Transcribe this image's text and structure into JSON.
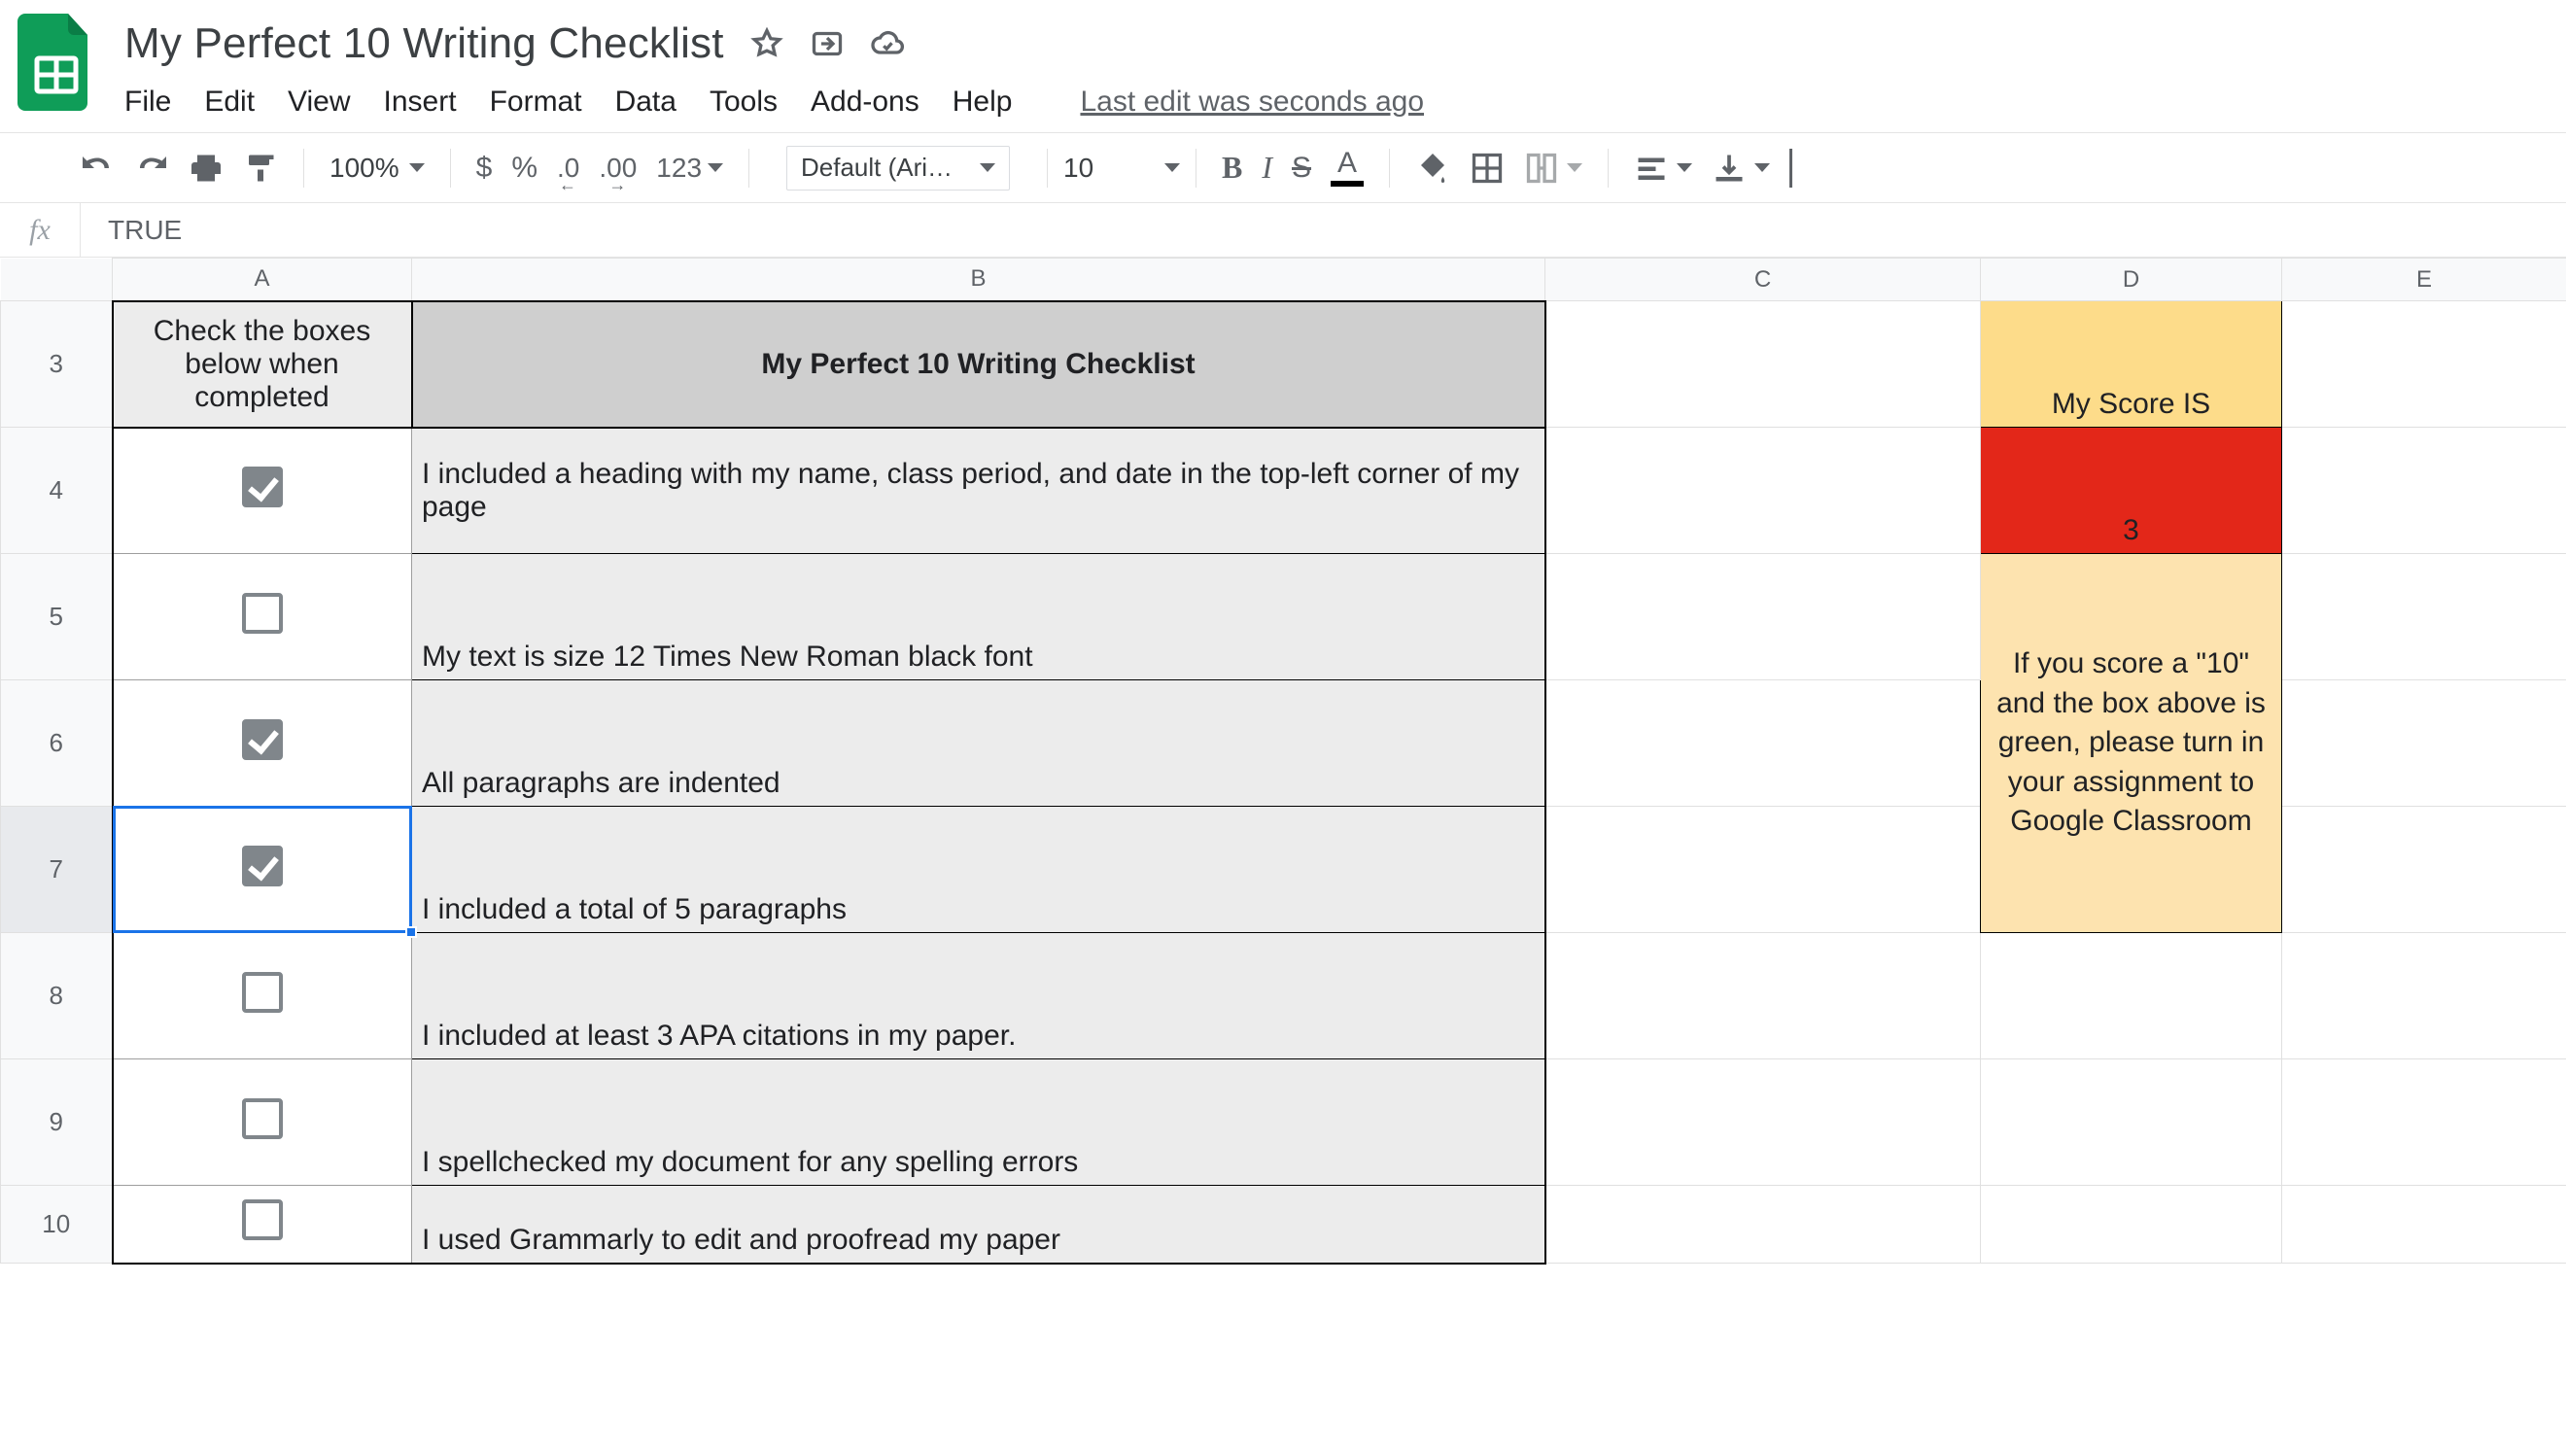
{
  "header": {
    "doc_title": "My Perfect 10 Writing Checklist",
    "menu": [
      "File",
      "Edit",
      "View",
      "Insert",
      "Format",
      "Data",
      "Tools",
      "Add-ons",
      "Help"
    ],
    "last_edit": "Last edit was seconds ago"
  },
  "toolbar": {
    "zoom": "100%",
    "currency": "$",
    "percent": "%",
    "dec_less": ".0",
    "dec_more": ".00",
    "num_format": "123",
    "font_name": "Default (Ari…",
    "font_size": "10",
    "bold": "B",
    "italic": "I",
    "strike": "S",
    "text_color": "A"
  },
  "formula_bar": {
    "fx": "fx",
    "value": "TRUE"
  },
  "columns": [
    "A",
    "B",
    "C",
    "D",
    "E"
  ],
  "row_numbers": [
    "3",
    "4",
    "5",
    "6",
    "7",
    "8",
    "9",
    "10"
  ],
  "selected_row_index": 4,
  "a_header": "Check the boxes below when completed",
  "b_header": "My Perfect 10 Writing Checklist",
  "items": [
    {
      "checked": true,
      "text": "I included a heading with my name, class period, and date in the top-left corner of my page"
    },
    {
      "checked": false,
      "text": "My text is size 12 Times New Roman black font"
    },
    {
      "checked": true,
      "text": "All paragraphs are indented"
    },
    {
      "checked": true,
      "text": "I included a total of 5 paragraphs"
    },
    {
      "checked": false,
      "text": "I included at least 3 APA citations in my paper."
    },
    {
      "checked": false,
      "text": "I spellchecked my document for any spelling errors"
    },
    {
      "checked": false,
      "text": "I used Grammarly to edit and proofread my paper"
    }
  ],
  "score_label": "My Score IS",
  "score_value": "3",
  "score_note": "If you score a \"10\" and the box above is green, please turn in your assignment to Google Classroom"
}
